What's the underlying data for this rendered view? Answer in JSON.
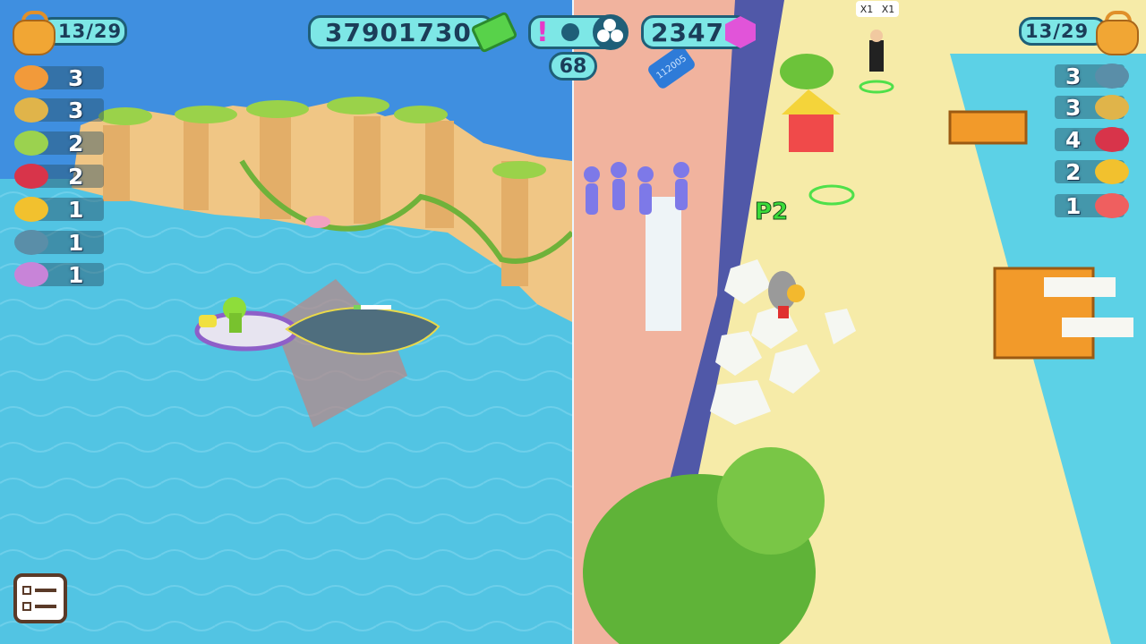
{
  "hud": {
    "money": "37901730",
    "gems": "2347",
    "level_badge": "68",
    "alert_glyph": "!",
    "pin_label": "112005"
  },
  "player1": {
    "capacity": "13/29",
    "catches": [
      {
        "fish": "shrimp",
        "count": "3",
        "color": "#f29a3a"
      },
      {
        "fish": "swordfish",
        "count": "3",
        "color": "#e0b44a"
      },
      {
        "fish": "eel",
        "count": "2",
        "color": "#9bd24f"
      },
      {
        "fish": "red-jellyfish",
        "count": "2",
        "color": "#d8344a"
      },
      {
        "fish": "pufferfish",
        "count": "1",
        "color": "#f2c12e"
      },
      {
        "fish": "shark",
        "count": "1",
        "color": "#5a8ea8"
      },
      {
        "fish": "octopus",
        "count": "1",
        "color": "#c884d8"
      }
    ]
  },
  "player2": {
    "capacity": "13/29",
    "tag": "P2",
    "multiplier_a": "X1",
    "multiplier_b": "X1",
    "catches": [
      {
        "fish": "shark",
        "count": "3",
        "color": "#5a8ea8"
      },
      {
        "fish": "swordfish",
        "count": "3",
        "color": "#e0b44a"
      },
      {
        "fish": "red-jellyfish",
        "count": "4",
        "color": "#d8344a"
      },
      {
        "fish": "pufferfish",
        "count": "2",
        "color": "#f2c12e"
      },
      {
        "fish": "koi",
        "count": "1",
        "color": "#ef5f5f"
      }
    ]
  },
  "icons": {
    "cash": "cash-icon",
    "gem": "gem-icon",
    "settings": "gear-icon",
    "menu": "task-list-icon",
    "bag": "backpack-icon"
  }
}
